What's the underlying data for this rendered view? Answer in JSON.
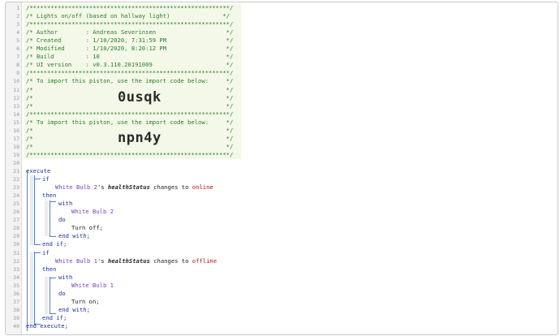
{
  "code_lines": [
    {
      "n": "1",
      "text": "/*********************************************************/"
    },
    {
      "n": "2",
      "text": "/* Lights on/off (based on hallway light)               */"
    },
    {
      "n": "3",
      "text": "/*********************************************************/"
    },
    {
      "n": "4",
      "text": "/* Author        : Andreas Severinsen                    */"
    },
    {
      "n": "5",
      "text": "/* Created       : 1/10/2020, 7:31:59 PM                 */"
    },
    {
      "n": "6",
      "text": "/* Modified      : 1/10/2020, 8:20:12 PM                 */"
    },
    {
      "n": "7",
      "text": "/* Build         : 10                                    */"
    },
    {
      "n": "8",
      "text": "/* UI version    : v0.3.110.20191009                     */"
    },
    {
      "n": "9",
      "text": "/*********************************************************/"
    },
    {
      "n": "10",
      "text": "/* To import this piston, use the import code below:     */"
    },
    {
      "n": "11",
      "text": "/*                                                       */"
    },
    {
      "n": "12",
      "text": "/*                                                       */"
    },
    {
      "n": "13",
      "text": "/*                                                       */"
    },
    {
      "n": "14",
      "text": "/*********************************************************/"
    },
    {
      "n": "15",
      "text": "/* To import this piston, use the import code below:     */"
    },
    {
      "n": "16",
      "text": "/*                                                       */"
    },
    {
      "n": "17",
      "text": "/*                                                       */"
    },
    {
      "n": "18",
      "text": "/*                                                       */"
    },
    {
      "n": "19",
      "text": "/*********************************************************/"
    },
    {
      "n": "20",
      "text": ""
    },
    {
      "n": "21",
      "text": "execute"
    },
    {
      "n": "22",
      "text": "if"
    },
    {
      "n": "23",
      "text": ""
    },
    {
      "n": "24",
      "text": "then"
    },
    {
      "n": "25",
      "text": "with"
    },
    {
      "n": "26",
      "text": "White Bulb 2"
    },
    {
      "n": "27",
      "text": "do"
    },
    {
      "n": "28",
      "text": "Turn off;"
    },
    {
      "n": "29",
      "text": "end with;"
    },
    {
      "n": "30",
      "text": "end if;"
    },
    {
      "n": "31",
      "text": "if"
    },
    {
      "n": "32",
      "text": ""
    },
    {
      "n": "33",
      "text": "then"
    },
    {
      "n": "34",
      "text": "with"
    },
    {
      "n": "35",
      "text": "White Bulb 1"
    },
    {
      "n": "36",
      "text": "do"
    },
    {
      "n": "37",
      "text": "Turn on;"
    },
    {
      "n": "38",
      "text": "end with;"
    },
    {
      "n": "39",
      "text": "end if;"
    },
    {
      "n": "40",
      "text": "end execute;"
    }
  ],
  "import_codes": [
    "0usqk",
    "npn4y"
  ],
  "conditions": [
    {
      "device": "White Bulb 2",
      "possessive": "'s ",
      "attribute": "healthStatus",
      "op": " changes to ",
      "value": "online"
    },
    {
      "device": "White Bulb 1",
      "possessive": "'s ",
      "attribute": "healthStatus",
      "op": " changes to ",
      "value": "offline"
    }
  ],
  "colors": {
    "comment": "#2a7d2a",
    "keyword": "#1c2fa8",
    "device": "#7a3fc8",
    "value": "#a8151b",
    "bracket": "#4f7fd6"
  }
}
